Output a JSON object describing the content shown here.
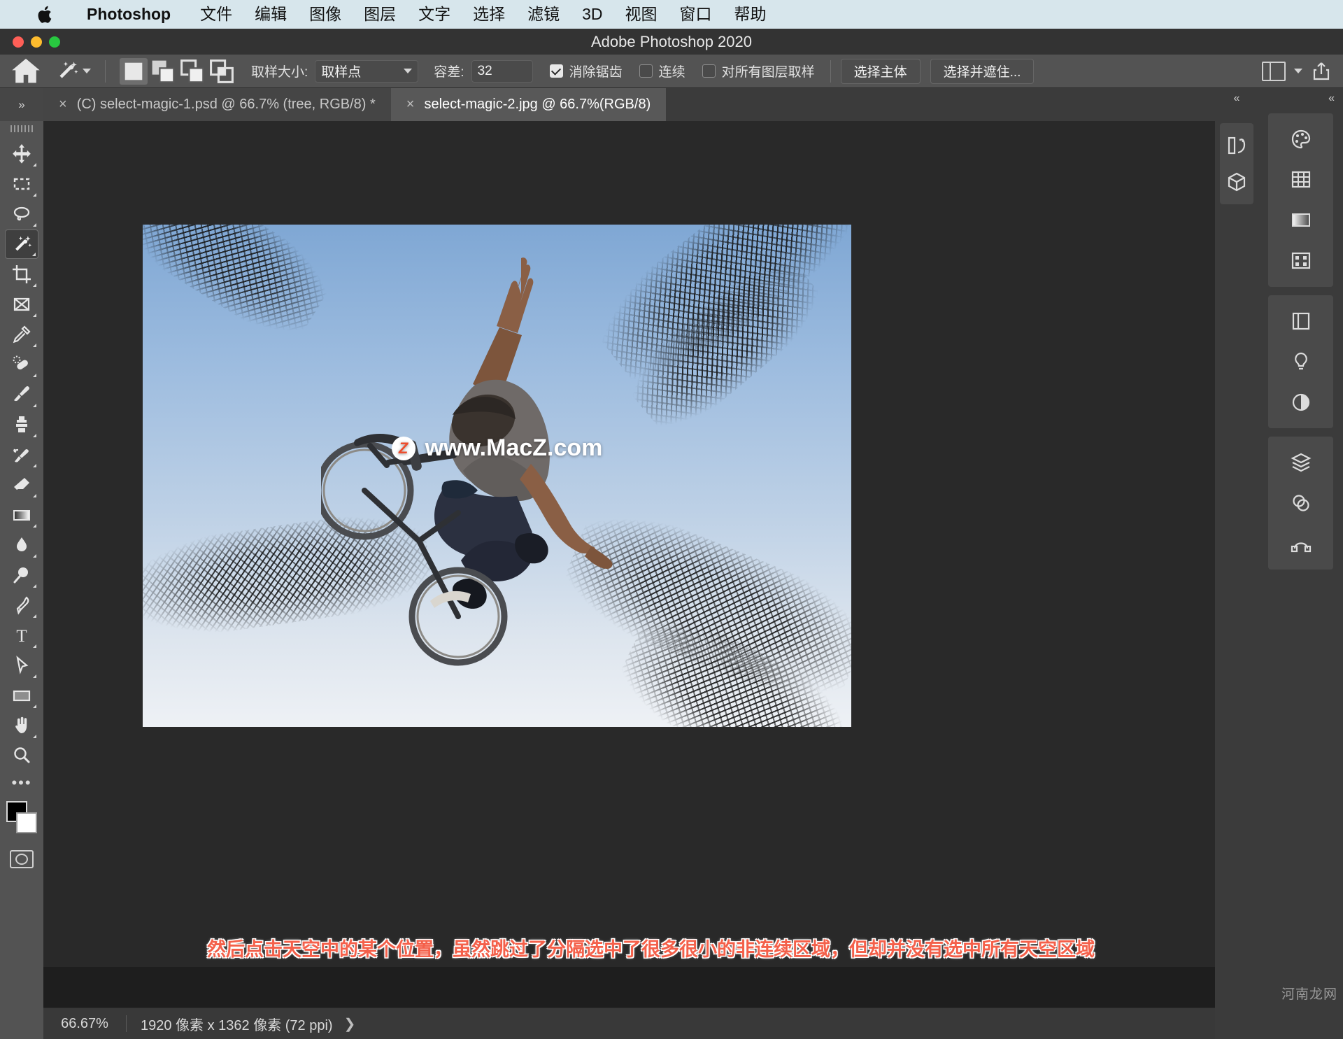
{
  "macmenu": {
    "apple_icon": "apple-logo",
    "items": [
      {
        "label": "Photoshop",
        "bold": true
      },
      {
        "label": "文件"
      },
      {
        "label": "编辑"
      },
      {
        "label": "图像"
      },
      {
        "label": "图层"
      },
      {
        "label": "文字"
      },
      {
        "label": "选择"
      },
      {
        "label": "滤镜"
      },
      {
        "label": "3D"
      },
      {
        "label": "视图"
      },
      {
        "label": "窗口"
      },
      {
        "label": "帮助"
      }
    ]
  },
  "titlebar": {
    "title": "Adobe Photoshop 2020"
  },
  "options": {
    "home_icon": "home-icon",
    "tool_icon": "magic-wand-icon",
    "selection_modes": [
      "new-selection",
      "add-to-selection",
      "subtract-from-selection",
      "intersect-selection"
    ],
    "sample_size_label": "取样大小:",
    "sample_size_value": "取样点",
    "tolerance_label": "容差:",
    "tolerance_value": "32",
    "antialias_label": "消除锯齿",
    "antialias_checked": true,
    "contiguous_label": "连续",
    "contiguous_checked": false,
    "all_layers_label": "对所有图层取样",
    "all_layers_checked": false,
    "select_subject_label": "选择主体",
    "select_and_mask_label": "选择并遮住...",
    "panel_icon": "workspace-panel-icon",
    "chevron_icon": "chevron-down-icon",
    "share_icon": "share-icon"
  },
  "tabs": {
    "collapse_icon": "chevron-double-right-icon",
    "items": [
      {
        "title": "(C) select-magic-1.psd @ 66.7% (tree, RGB/8) *",
        "active": false,
        "close_icon": "close-icon"
      },
      {
        "title": "select-magic-2.jpg @ 66.7%(RGB/8)",
        "active": true,
        "close_icon": "close-icon"
      }
    ]
  },
  "toolbar": {
    "tools": [
      {
        "name": "move-tool",
        "icon": "move-icon",
        "active": false
      },
      {
        "name": "rectangular-marquee-tool",
        "icon": "marquee-icon",
        "active": false
      },
      {
        "name": "lasso-tool",
        "icon": "lasso-icon",
        "active": false
      },
      {
        "name": "magic-wand-tool",
        "icon": "magic-wand-icon",
        "active": true
      },
      {
        "name": "crop-tool",
        "icon": "crop-icon",
        "active": false
      },
      {
        "name": "frame-tool",
        "icon": "frame-icon",
        "active": false
      },
      {
        "name": "eyedropper-tool",
        "icon": "eyedropper-icon",
        "active": false
      },
      {
        "name": "healing-brush-tool",
        "icon": "healing-brush-icon",
        "active": false
      },
      {
        "name": "brush-tool",
        "icon": "brush-icon",
        "active": false
      },
      {
        "name": "clone-stamp-tool",
        "icon": "clone-stamp-icon",
        "active": false
      },
      {
        "name": "history-brush-tool",
        "icon": "history-brush-icon",
        "active": false
      },
      {
        "name": "eraser-tool",
        "icon": "eraser-icon",
        "active": false
      },
      {
        "name": "gradient-tool",
        "icon": "gradient-icon",
        "active": false
      },
      {
        "name": "blur-tool",
        "icon": "blur-drop-icon",
        "active": false
      },
      {
        "name": "dodge-tool",
        "icon": "dodge-icon",
        "active": false
      },
      {
        "name": "pen-tool",
        "icon": "pen-icon",
        "active": false
      },
      {
        "name": "type-tool",
        "icon": "type-T-icon",
        "active": false
      },
      {
        "name": "path-selection-tool",
        "icon": "path-arrow-icon",
        "active": false
      },
      {
        "name": "rectangle-tool",
        "icon": "rectangle-icon",
        "active": false
      },
      {
        "name": "hand-tool",
        "icon": "hand-icon",
        "active": false
      },
      {
        "name": "zoom-tool",
        "icon": "zoom-magnifier-icon",
        "active": false
      }
    ],
    "more_tools_icon": "ellipsis-icon",
    "foreground_color": "#000000",
    "background_color": "#ffffff",
    "quickmask_icon": "quick-mask-icon"
  },
  "canvas": {
    "watermark_text": "www.MacZ.com",
    "watermark_badge": "Z",
    "annotation": "然后点击天空中的某个位置，虽然跳过了分隔选中了很多很小的非连续区域，但却并没有选中所有天空区域",
    "annotation_color": "#f4604a"
  },
  "statusbar": {
    "zoom": "66.67%",
    "dimensions": "1920 像素 x 1362 像素 (72 ppi)",
    "caret_icon": "chevron-right-icon"
  },
  "panels": {
    "rail_a": {
      "collapse_icon": "chevron-double-left-icon",
      "items": [
        {
          "name": "panel-libraries",
          "icon": "libraries-icon"
        },
        {
          "name": "panel-3d",
          "icon": "cube-icon"
        }
      ]
    },
    "rail_b": {
      "collapse_icon": "chevron-double-left-icon",
      "group1": [
        {
          "name": "panel-color",
          "icon": "color-palette-icon"
        },
        {
          "name": "panel-swatches",
          "icon": "swatches-grid-icon"
        },
        {
          "name": "panel-gradients",
          "icon": "gradient-panel-icon"
        },
        {
          "name": "panel-patterns",
          "icon": "patterns-icon"
        }
      ],
      "group2": [
        {
          "name": "panel-properties",
          "icon": "properties-icon"
        },
        {
          "name": "panel-adjustments",
          "icon": "bulb-icon"
        },
        {
          "name": "panel-styles",
          "icon": "half-circle-icon"
        }
      ],
      "group3": [
        {
          "name": "panel-layers",
          "icon": "layers-icon"
        },
        {
          "name": "panel-channels",
          "icon": "channels-icon"
        },
        {
          "name": "panel-paths",
          "icon": "paths-icon"
        }
      ]
    },
    "watermark": "河南龙网"
  }
}
